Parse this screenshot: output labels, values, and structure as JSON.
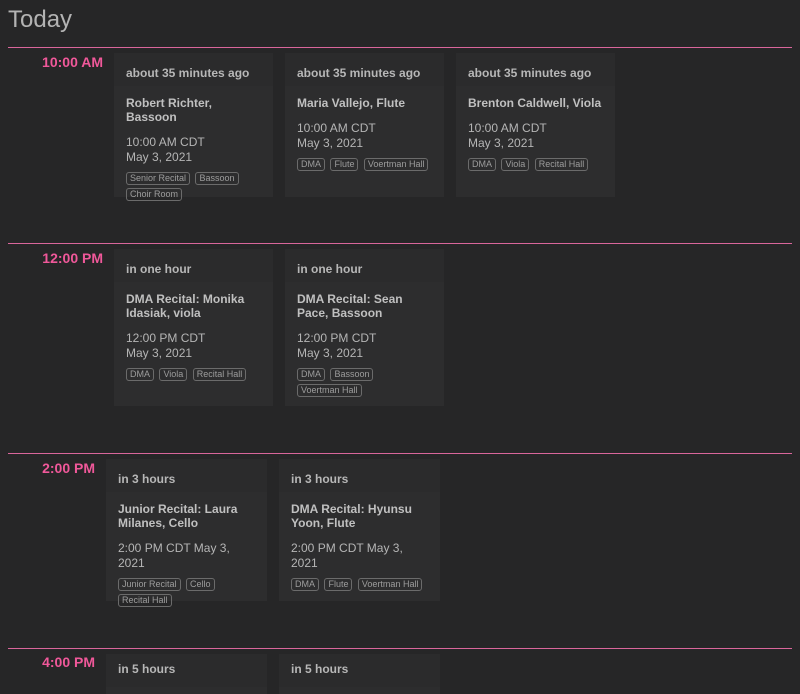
{
  "page": {
    "title": "Today"
  },
  "slots": [
    {
      "time": "10:00 AM",
      "events": [
        {
          "relative": "about 35 minutes ago",
          "title": "Robert Richter, Bassoon",
          "time": "10:00 AM CDT",
          "date": "May 3, 2021",
          "tags": [
            "Senior Recital",
            "Bassoon",
            "Choir Room"
          ]
        },
        {
          "relative": "about 35 minutes ago",
          "title": "Maria Vallejo, Flute",
          "time": "10:00 AM CDT",
          "date": "May 3, 2021",
          "tags": [
            "DMA",
            "Flute",
            "Voertman Hall"
          ]
        },
        {
          "relative": "about 35 minutes ago",
          "title": "Brenton Caldwell, Viola",
          "time": "10:00 AM CDT",
          "date": "May 3, 2021",
          "tags": [
            "DMA",
            "Viola",
            "Recital Hall"
          ]
        }
      ]
    },
    {
      "time": "12:00 PM",
      "events": [
        {
          "relative": "in one hour",
          "title": "DMA Recital: Monika Idasiak, viola",
          "time": "12:00 PM CDT",
          "date": "May 3, 2021",
          "tags": [
            "DMA",
            "Viola",
            "Recital Hall"
          ]
        },
        {
          "relative": "in one hour",
          "title": "DMA Recital: Sean Pace, Bassoon",
          "time": "12:00 PM CDT",
          "date": "May 3, 2021",
          "tags": [
            "DMA",
            "Bassoon",
            "Voertman Hall"
          ]
        }
      ]
    },
    {
      "time": "2:00 PM",
      "events": [
        {
          "relative": "in 3 hours",
          "title": "Junior Recital: Laura Milanes, Cello",
          "time": "2:00 PM CDT May 3, 2021",
          "date": "",
          "tags": [
            "Junior Recital",
            "Cello",
            "Recital Hall"
          ]
        },
        {
          "relative": "in 3 hours",
          "title": "DMA Recital: Hyunsu Yoon, Flute",
          "time": "2:00 PM CDT May 3, 2021",
          "date": "",
          "tags": [
            "DMA",
            "Flute",
            "Voertman Hall"
          ]
        }
      ]
    },
    {
      "time": "4:00 PM",
      "events": [
        {
          "relative": "in 5 hours"
        },
        {
          "relative": "in 5 hours"
        }
      ]
    }
  ]
}
